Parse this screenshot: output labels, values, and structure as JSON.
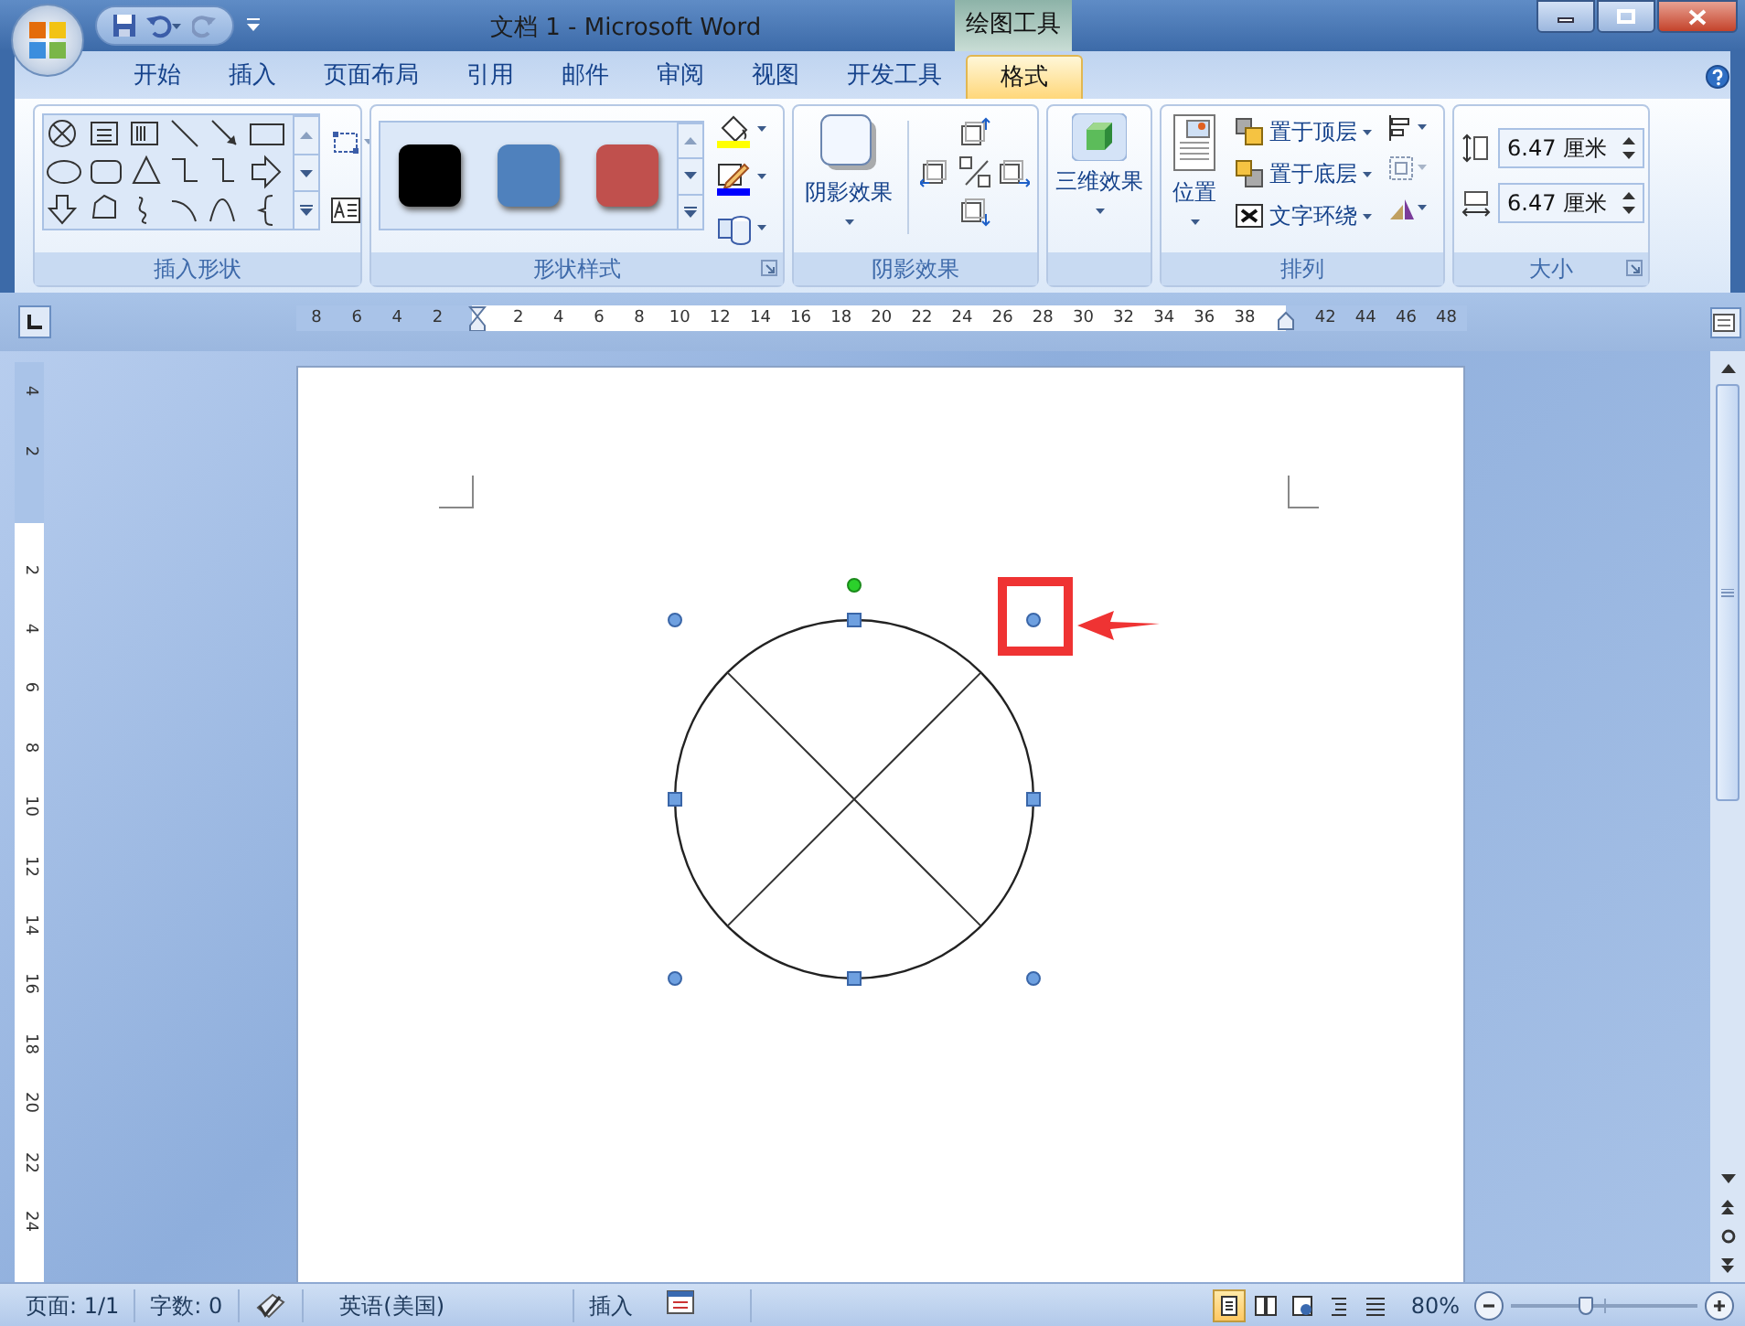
{
  "window": {
    "title": "文档 1 - Microsoft Word",
    "context_label": "绘图工具"
  },
  "tabs": [
    {
      "label": "开始",
      "selected": false
    },
    {
      "label": "插入",
      "selected": false
    },
    {
      "label": "页面布局",
      "selected": false
    },
    {
      "label": "引用",
      "selected": false
    },
    {
      "label": "邮件",
      "selected": false
    },
    {
      "label": "审阅",
      "selected": false
    },
    {
      "label": "视图",
      "selected": false
    },
    {
      "label": "开发工具",
      "selected": false
    },
    {
      "label": "格式",
      "selected": true
    }
  ],
  "ribbon": {
    "insert_shapes": {
      "label": "插入形状"
    },
    "shape_styles": {
      "label": "形状样式",
      "swatches": [
        {
          "color": "#000000"
        },
        {
          "color": "#4f81bd"
        },
        {
          "color": "#c0504d"
        }
      ]
    },
    "shadow_effects": {
      "label": "阴影效果",
      "button": "阴影效果"
    },
    "three_d": {
      "button": "三维效果"
    },
    "arrange": {
      "label": "排列",
      "position": "位置",
      "items": [
        "置于顶层",
        "置于底层",
        "文字环绕"
      ]
    },
    "size": {
      "label": "大小",
      "fields": [
        {
          "value": "6.47 厘米"
        },
        {
          "value": "6.47 厘米"
        }
      ]
    }
  },
  "ruler": {
    "horizontal": [
      {
        "kind": "tick",
        "label": "8"
      },
      {
        "kind": "tick",
        "label": "6"
      },
      {
        "kind": "tick",
        "label": "4"
      },
      {
        "kind": "tick",
        "label": "2"
      },
      {
        "kind": "marker"
      },
      {
        "kind": "tick",
        "label": "2"
      },
      {
        "kind": "tick",
        "label": "4"
      },
      {
        "kind": "tick",
        "label": "6"
      },
      {
        "kind": "tick",
        "label": "8"
      },
      {
        "kind": "tick",
        "label": "10"
      },
      {
        "kind": "tick",
        "label": "12"
      },
      {
        "kind": "tick",
        "label": "14"
      },
      {
        "kind": "tick",
        "label": "16"
      },
      {
        "kind": "tick",
        "label": "18"
      },
      {
        "kind": "tick",
        "label": "20"
      },
      {
        "kind": "tick",
        "label": "22"
      },
      {
        "kind": "tick",
        "label": "24"
      },
      {
        "kind": "tick",
        "label": "26"
      },
      {
        "kind": "tick",
        "label": "28"
      },
      {
        "kind": "tick",
        "label": "30"
      },
      {
        "kind": "tick",
        "label": "32"
      },
      {
        "kind": "tick",
        "label": "34"
      },
      {
        "kind": "tick",
        "label": "36"
      },
      {
        "kind": "tick",
        "label": "38"
      },
      {
        "kind": "marker"
      },
      {
        "kind": "tick",
        "label": "42"
      },
      {
        "kind": "tick",
        "label": "44"
      },
      {
        "kind": "tick",
        "label": "46"
      },
      {
        "kind": "tick",
        "label": "48"
      }
    ],
    "vertical": [
      {
        "kind": "tick",
        "label": "4"
      },
      {
        "kind": "tick",
        "label": "2"
      },
      {
        "kind": "gap"
      },
      {
        "kind": "tick",
        "label": "2"
      },
      {
        "kind": "tick",
        "label": "4"
      },
      {
        "kind": "tick",
        "label": "6"
      },
      {
        "kind": "tick",
        "label": "8"
      },
      {
        "kind": "tick",
        "label": "10"
      },
      {
        "kind": "tick",
        "label": "12"
      },
      {
        "kind": "tick",
        "label": "14"
      },
      {
        "kind": "tick",
        "label": "16"
      },
      {
        "kind": "tick",
        "label": "18"
      },
      {
        "kind": "tick",
        "label": "20"
      },
      {
        "kind": "tick",
        "label": "22"
      },
      {
        "kind": "tick",
        "label": "24"
      }
    ]
  },
  "status_bar": {
    "page": "页面: 1/1",
    "words": "字数: 0",
    "language": "英语(美国)",
    "mode": "插入",
    "views": [
      {
        "selected": true
      },
      {
        "selected": false
      },
      {
        "selected": false
      },
      {
        "selected": false
      },
      {
        "selected": false
      }
    ],
    "zoom": "80%",
    "zoom_slider": {
      "level": 0.4
    }
  }
}
